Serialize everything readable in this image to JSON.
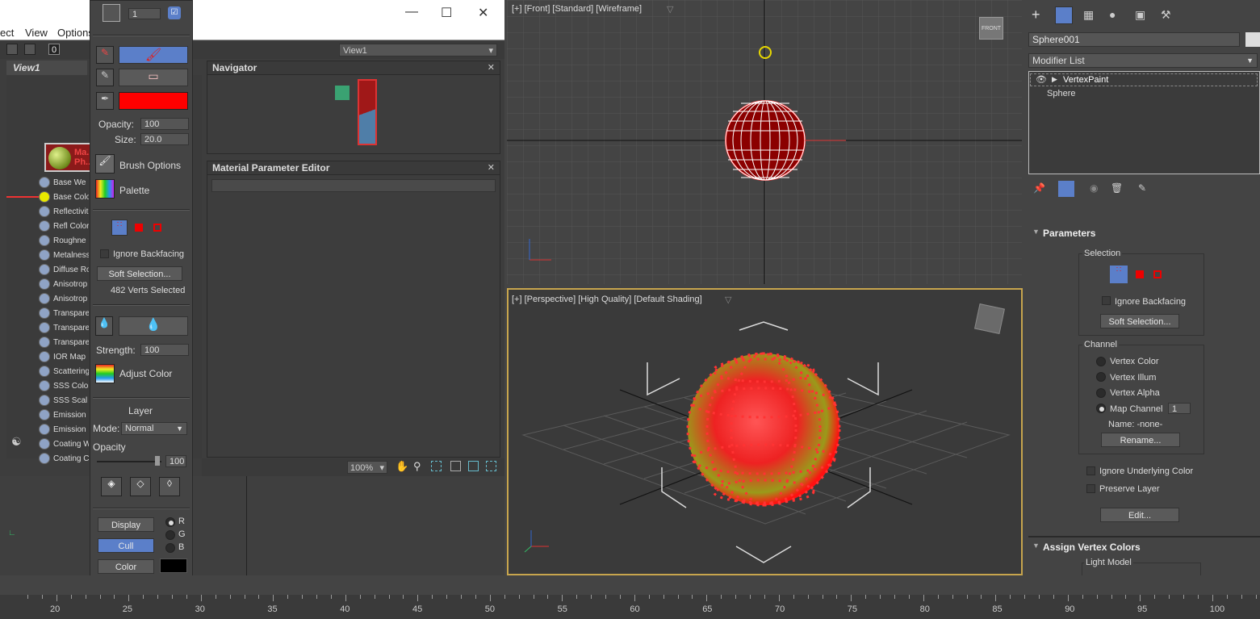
{
  "slate": {
    "menu": [
      "ect",
      "View",
      "Options"
    ],
    "view_tab": "View1",
    "view_dropdown": "View1",
    "zoom": "100%",
    "material_node_label": "Ma... Ph...",
    "slots": [
      "Base We",
      "Base Colo",
      "Reflectivit",
      "Refl Color",
      "Roughne",
      "Metalness",
      "Diffuse Ro",
      "Anisotrop",
      "Anisotrop",
      "Transpare",
      "Transpare",
      "Transpare",
      "IOR Map",
      "Scattering",
      "SSS Colo",
      "SSS Scal",
      "Emission",
      "Emission",
      "Coating W",
      "Coating C"
    ],
    "navigator_title": "Navigator",
    "param_editor_title": "Material Parameter Editor"
  },
  "paint": {
    "count": "1",
    "opacity_label": "Opacity:",
    "opacity": "100",
    "size_label": "Size:",
    "size": "20.0",
    "brush_options": "Brush Options",
    "palette": "Palette",
    "ignore_backfacing": "Ignore Backfacing",
    "soft_selection": "Soft Selection...",
    "verts_selected": "482 Verts Selected",
    "strength_label": "Strength:",
    "strength": "100",
    "adjust_color": "Adjust Color",
    "layer_title": "Layer",
    "mode_label": "Mode:",
    "mode_value": "Normal",
    "layer_opacity_label": "Opacity",
    "layer_opacity": "100",
    "display": "Display",
    "cull": "Cull",
    "color": "Color",
    "channels": [
      "R",
      "G",
      "B"
    ],
    "paint_color": "#ff0000"
  },
  "viewports": {
    "front_label": "[+] [Front] [Standard] [Wireframe]",
    "front_cube": "FRONT",
    "persp_label": "[+] [Perspective] [High Quality] [Default Shading]"
  },
  "cmd": {
    "object_name": "Sphere001",
    "modifier_list": "Modifier List",
    "stack": [
      "VertexPaint",
      "Sphere"
    ],
    "parameters": "Parameters",
    "selection": "Selection",
    "ignore_backfacing": "Ignore Backfacing",
    "soft_selection": "Soft Selection...",
    "channel": "Channel",
    "channel_options": [
      "Vertex Color",
      "Vertex Illum",
      "Vertex Alpha",
      "Map Channel"
    ],
    "map_channel_value": "1",
    "name_label": "Name: -none-",
    "rename": "Rename...",
    "ignore_underlying": "Ignore Underlying Color",
    "preserve_layer": "Preserve Layer",
    "edit": "Edit...",
    "assign_vertex_colors": "Assign Vertex Colors",
    "light_model": "Light Model"
  },
  "timeline": {
    "ticks": [
      "20",
      "25",
      "30",
      "35",
      "40",
      "45",
      "50",
      "55",
      "60",
      "65",
      "70",
      "75",
      "80",
      "85",
      "90",
      "95",
      "100"
    ]
  }
}
